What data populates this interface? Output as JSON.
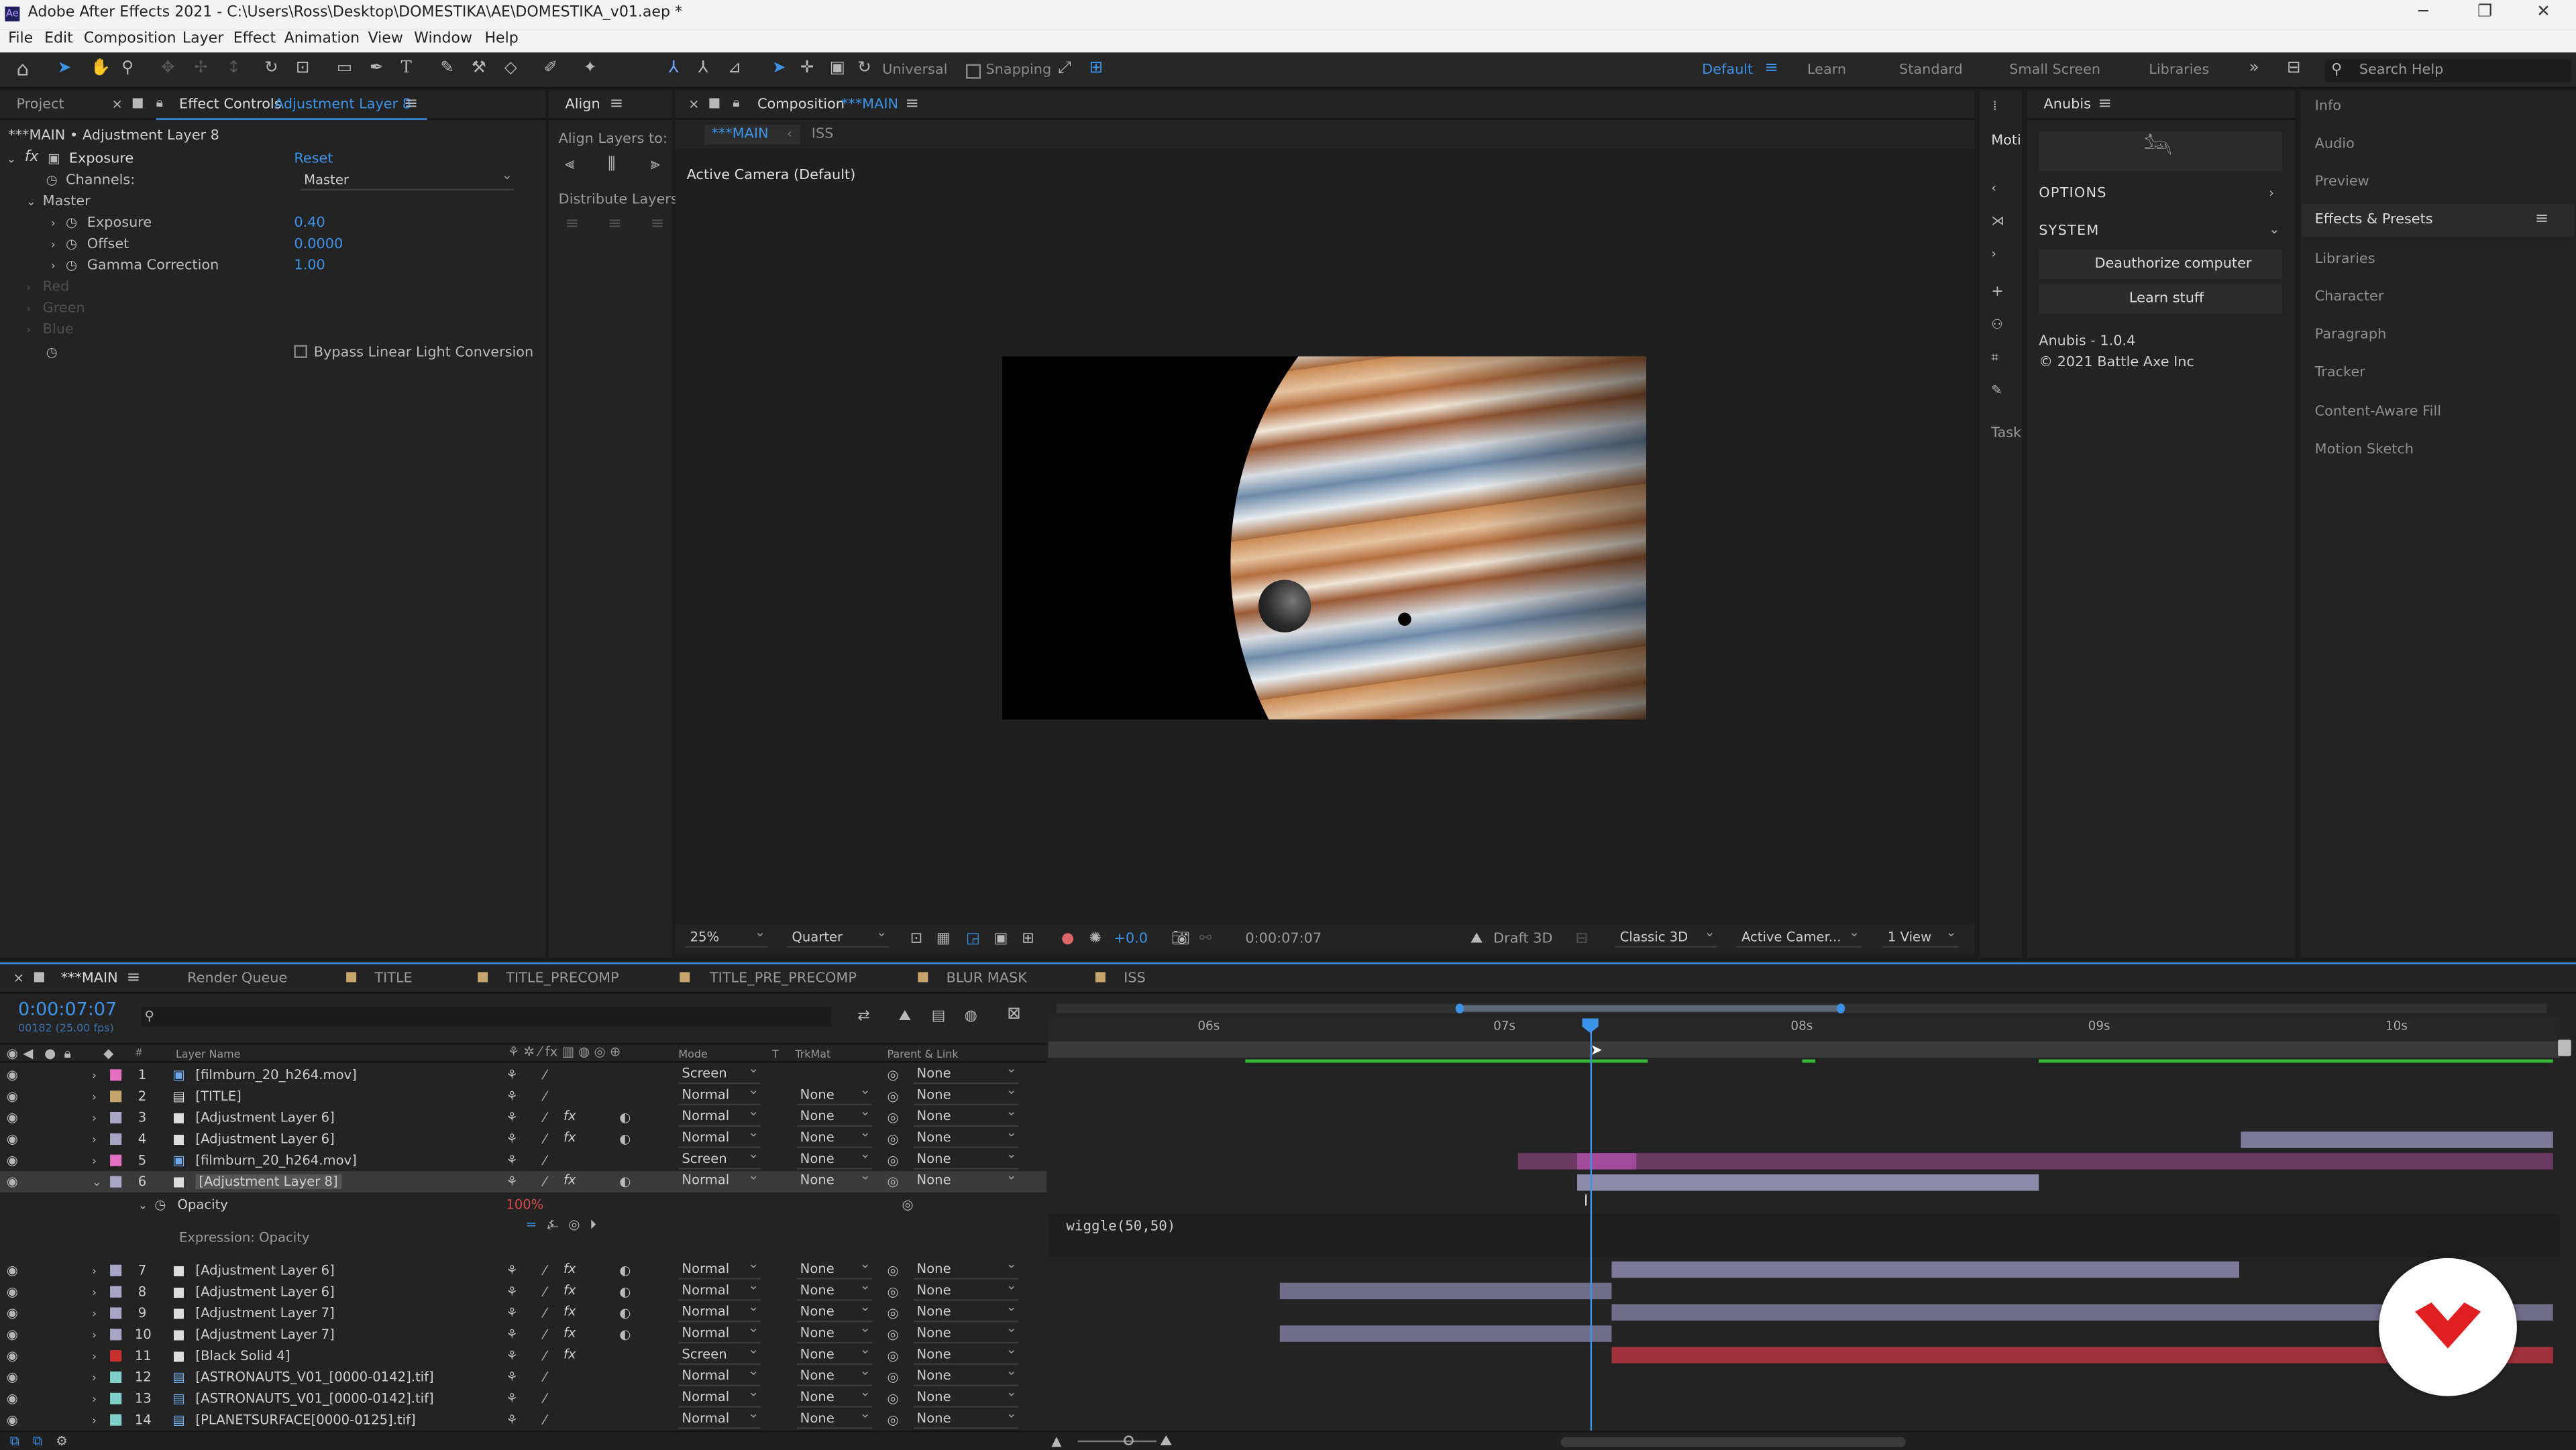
{
  "titlebar": {
    "title": "Adobe After Effects 2021 - C:\\Users\\Ross\\Desktop\\DOMESTIKA\\AE\\DOMESTIKA_v01.aep *",
    "minimize": "─",
    "restore": "❐",
    "close": "✕"
  },
  "menu": [
    "File",
    "Edit",
    "Composition",
    "Layer",
    "Effect",
    "Animation",
    "View",
    "Window",
    "Help"
  ],
  "toolbar": {
    "universal": "Universal",
    "snapping": "Snapping"
  },
  "workspaces": [
    "Default",
    "Learn",
    "Standard",
    "Small Screen",
    "Libraries"
  ],
  "search_help": "Search Help",
  "project_tab": "Project",
  "effect_controls": {
    "tab_prefix": "Effect Controls",
    "tab_layer": "Adjustment Layer 8",
    "layer_path": "***MAIN • Adjustment Layer 8",
    "effect_name": "Exposure",
    "reset": "Reset",
    "channels_label": "Channels:",
    "channels_value": "Master",
    "master": "Master",
    "params": [
      {
        "name": "Exposure",
        "value": "0.40"
      },
      {
        "name": "Offset",
        "value": "0.0000"
      },
      {
        "name": "Gamma Correction",
        "value": "1.00"
      }
    ],
    "disabled_groups": [
      "Red",
      "Green",
      "Blue"
    ],
    "bypass": "Bypass Linear Light Conversion"
  },
  "align": {
    "tab": "Align",
    "align_layers_to": "Align Layers to:",
    "distribute": "Distribute Layers:"
  },
  "composition": {
    "tab_prefix": "Composition",
    "tab_name": "***MAIN",
    "subtabs": [
      "***MAIN",
      "ISS"
    ],
    "camera_label": "Active Camera (Default)",
    "zoom": "25%",
    "resolution": "Quarter",
    "exposure": "+0.0",
    "timecode": "0:00:07:07",
    "draft3d": "Draft 3D",
    "renderer": "Classic 3D",
    "camera": "Active Camer...",
    "views": "1 View"
  },
  "narrow_panel": {
    "tab": "Moti",
    "task": "Task"
  },
  "anubis": {
    "tab": "Anubis",
    "options": "OPTIONS",
    "system": "SYSTEM",
    "deauthorize": "Deauthorize computer",
    "learn": "Learn stuff",
    "version": "Anubis - 1.0.4",
    "copyright": "© 2021 Battle Axe Inc"
  },
  "right_panels": [
    "Info",
    "Audio",
    "Preview",
    "Effects & Presets",
    "Libraries",
    "Character",
    "Paragraph",
    "Tracker",
    "Content-Aware Fill",
    "Motion Sketch"
  ],
  "timeline": {
    "tabs": [
      "***MAIN",
      "Render Queue",
      "TITLE",
      "TITLE_PRECOMP",
      "TITLE_PRE_PRECOMP",
      "BLUR MASK",
      "ISS"
    ],
    "timecode": "0:00:07:07",
    "fps": "00182 (25.00 fps)",
    "col_layer_name": "Layer Name",
    "col_mode": "Mode",
    "col_t": "T",
    "col_trkmat": "TrkMat",
    "col_parent": "Parent & Link",
    "ruler": [
      "06s",
      "07s",
      "08s",
      "09s",
      "10s"
    ],
    "layers": [
      {
        "num": "1",
        "name": "[filmburn_20_h264.mov]",
        "mode": "Screen",
        "trk": "",
        "parent": "None"
      },
      {
        "num": "2",
        "name": "[TITLE]",
        "mode": "Normal",
        "trk": "None",
        "parent": "None"
      },
      {
        "num": "3",
        "name": "[Adjustment Layer 6]",
        "mode": "Normal",
        "trk": "None",
        "parent": "None"
      },
      {
        "num": "4",
        "name": "[Adjustment Layer 6]",
        "mode": "Normal",
        "trk": "None",
        "parent": "None"
      },
      {
        "num": "5",
        "name": "[filmburn_20_h264.mov]",
        "mode": "Screen",
        "trk": "None",
        "parent": "None"
      },
      {
        "num": "6",
        "name": "[Adjustment Layer 8]",
        "mode": "Normal",
        "trk": "None",
        "parent": "None"
      }
    ],
    "opacity_label": "Opacity",
    "opacity_value": "100%",
    "expression_label": "Expression: Opacity",
    "expression_code": "wiggle(50,50)",
    "layers2": [
      {
        "num": "7",
        "name": "[Adjustment Layer 6]",
        "mode": "Normal",
        "trk": "None",
        "parent": "None"
      },
      {
        "num": "8",
        "name": "[Adjustment Layer 6]",
        "mode": "Normal",
        "trk": "None",
        "parent": "None"
      },
      {
        "num": "9",
        "name": "[Adjustment Layer 7]",
        "mode": "Normal",
        "trk": "None",
        "parent": "None"
      },
      {
        "num": "10",
        "name": "[Adjustment Layer 7]",
        "mode": "Normal",
        "trk": "None",
        "parent": "None"
      },
      {
        "num": "11",
        "name": "[Black Solid 4]",
        "mode": "Screen",
        "trk": "None",
        "parent": "None"
      },
      {
        "num": "12",
        "name": "[ASTRONAUTS_V01_[0000-0142].tif]",
        "mode": "Normal",
        "trk": "None",
        "parent": "None"
      },
      {
        "num": "13",
        "name": "[ASTRONAUTS_V01_[0000-0142].tif]",
        "mode": "Normal",
        "trk": "None",
        "parent": "None"
      },
      {
        "num": "14",
        "name": "[PLANETSURFACE[0000-0125].tif]",
        "mode": "Normal",
        "trk": "None",
        "parent": "None"
      }
    ]
  },
  "colors": {
    "accent": "#3d93e8",
    "panel": "#232323",
    "bg": "#1b1b1b",
    "brand": "#e02020"
  }
}
